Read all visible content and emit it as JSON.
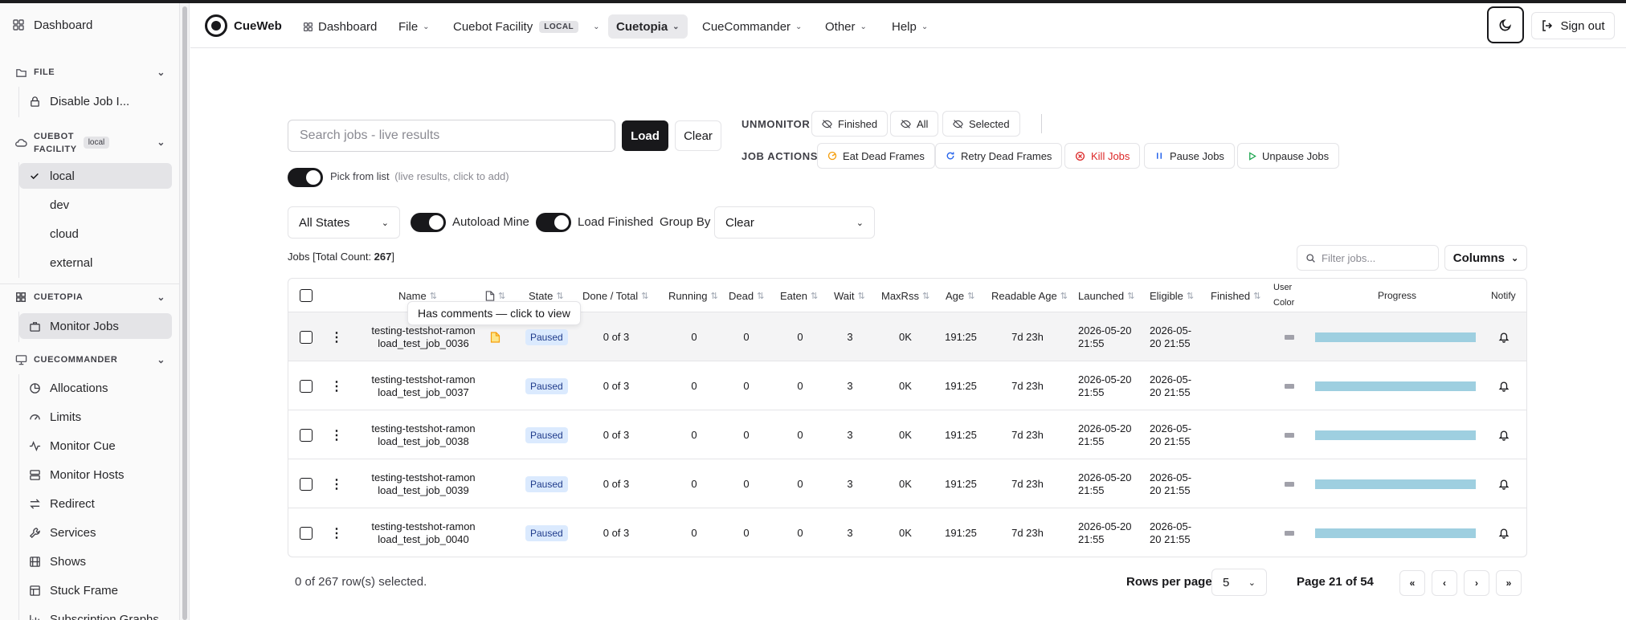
{
  "sidebar": {
    "dashboard": "Dashboard",
    "file_header": "FILE",
    "file_items": [
      "Disable Job I..."
    ],
    "facility_header": "CUEBOT FACILITY",
    "facility_header_l1": "CUEBOT",
    "facility_header_l2": "FACILITY",
    "facility_badge": "local",
    "facility_items": [
      "local",
      "dev",
      "cloud",
      "external"
    ],
    "cuetopia_header": "CUETOPIA",
    "cuetopia_items": [
      "Monitor Jobs"
    ],
    "cuecommander_header": "CUECOMMANDER",
    "cuecommander_items": [
      "Allocations",
      "Limits",
      "Monitor Cue",
      "Monitor Hosts",
      "Redirect",
      "Services",
      "Shows",
      "Stuck Frame",
      "Subscription Graphs"
    ]
  },
  "topnav": {
    "brand": "CueWeb",
    "dashboard": "Dashboard",
    "file": "File",
    "facility": "Cuebot Facility",
    "facility_tag": "LOCAL",
    "cuetopia": "Cuetopia",
    "cuecommander": "CueCommander",
    "other": "Other",
    "help": "Help",
    "signout": "Sign out"
  },
  "search": {
    "placeholder": "Search jobs - live results",
    "load": "Load",
    "clear": "Clear"
  },
  "unmonitor": {
    "label": "UNMONITOR",
    "finished": "Finished",
    "all": "All",
    "selected": "Selected"
  },
  "job_actions": {
    "label": "JOB ACTIONS",
    "eat": "Eat Dead Frames",
    "retry": "Retry Dead Frames",
    "kill": "Kill Jobs",
    "pause": "Pause Jobs",
    "unpause": "Unpause Jobs"
  },
  "pick": {
    "label": "Pick from list",
    "hint": "(live results, click to add)"
  },
  "filters": {
    "state": "All States",
    "autoload": "Autoload Mine",
    "load_finished": "Load Finished",
    "group_by_label": "Group By",
    "group_by_value": "Clear"
  },
  "jobs_count": {
    "prefix": "Jobs [Total Count: ",
    "count": "267",
    "suffix": "]"
  },
  "filter_placeholder": "Filter jobs...",
  "columns_btn": "Columns",
  "table": {
    "headers": {
      "name": "Name",
      "state": "State",
      "done_total": "Done / Total",
      "running": "Running",
      "dead": "Dead",
      "eaten": "Eaten",
      "wait": "Wait",
      "maxrss": "MaxRss",
      "age": "Age",
      "readable_age": "Readable Age",
      "launched": "Launched",
      "eligible": "Eligible",
      "finished": "Finished",
      "user_color_l1": "User",
      "user_color_l2": "Color",
      "progress": "Progress",
      "notify": "Notify"
    },
    "rows": [
      {
        "name_l1": "testing-testshot-ramon",
        "name_l2": "load_test_job_0036",
        "has_comment": true,
        "state": "Paused",
        "done_total": "0 of 3",
        "running": "0",
        "dead": "0",
        "eaten": "0",
        "wait": "3",
        "maxrss": "0K",
        "age": "191:25",
        "readable_age": "7d 23h",
        "launched_l1": "2026-05-20",
        "launched_l2": "21:55",
        "eligible_l1": "2026-05-",
        "eligible_l2": "20 21:55",
        "finished": "",
        "progress": 1.0
      },
      {
        "name_l1": "testing-testshot-ramon",
        "name_l2": "load_test_job_0037",
        "has_comment": false,
        "state": "Paused",
        "done_total": "0 of 3",
        "running": "0",
        "dead": "0",
        "eaten": "0",
        "wait": "3",
        "maxrss": "0K",
        "age": "191:25",
        "readable_age": "7d 23h",
        "launched_l1": "2026-05-20",
        "launched_l2": "21:55",
        "eligible_l1": "2026-05-",
        "eligible_l2": "20 21:55",
        "finished": "",
        "progress": 1.0
      },
      {
        "name_l1": "testing-testshot-ramon",
        "name_l2": "load_test_job_0038",
        "has_comment": false,
        "state": "Paused",
        "done_total": "0 of 3",
        "running": "0",
        "dead": "0",
        "eaten": "0",
        "wait": "3",
        "maxrss": "0K",
        "age": "191:25",
        "readable_age": "7d 23h",
        "launched_l1": "2026-05-20",
        "launched_l2": "21:55",
        "eligible_l1": "2026-05-",
        "eligible_l2": "20 21:55",
        "finished": "",
        "progress": 1.0
      },
      {
        "name_l1": "testing-testshot-ramon",
        "name_l2": "load_test_job_0039",
        "has_comment": false,
        "state": "Paused",
        "done_total": "0 of 3",
        "running": "0",
        "dead": "0",
        "eaten": "0",
        "wait": "3",
        "maxrss": "0K",
        "age": "191:25",
        "readable_age": "7d 23h",
        "launched_l1": "2026-05-20",
        "launched_l2": "21:55",
        "eligible_l1": "2026-05-",
        "eligible_l2": "20 21:55",
        "finished": "",
        "progress": 1.0
      },
      {
        "name_l1": "testing-testshot-ramon",
        "name_l2": "load_test_job_0040",
        "has_comment": false,
        "state": "Paused",
        "done_total": "0 of 3",
        "running": "0",
        "dead": "0",
        "eaten": "0",
        "wait": "3",
        "maxrss": "0K",
        "age": "191:25",
        "readable_age": "7d 23h",
        "launched_l1": "2026-05-20",
        "launched_l2": "21:55",
        "eligible_l1": "2026-05-",
        "eligible_l2": "20 21:55",
        "finished": "",
        "progress": 1.0
      }
    ]
  },
  "tooltip": "Has comments — click to view",
  "footer": {
    "selected": "0 of 267 row(s) selected.",
    "rows_per_page_label": "Rows per page",
    "rows_per_page_value": "5",
    "page_info": "Page 21 of 54"
  },
  "colors": {
    "accent": "#18181b",
    "progress": "#9ecfe0",
    "paused_bg": "#dbeafe",
    "kill": "#dc2626",
    "comment": "#f59e0b"
  },
  "icons": {
    "dashboard": "grid-icon",
    "file": "folder-icon",
    "facility": "cloud-icon",
    "cuetopia": "grid-icon",
    "cuecommander": "monitor-icon",
    "theme": "moon-icon",
    "signout": "logout-icon"
  }
}
